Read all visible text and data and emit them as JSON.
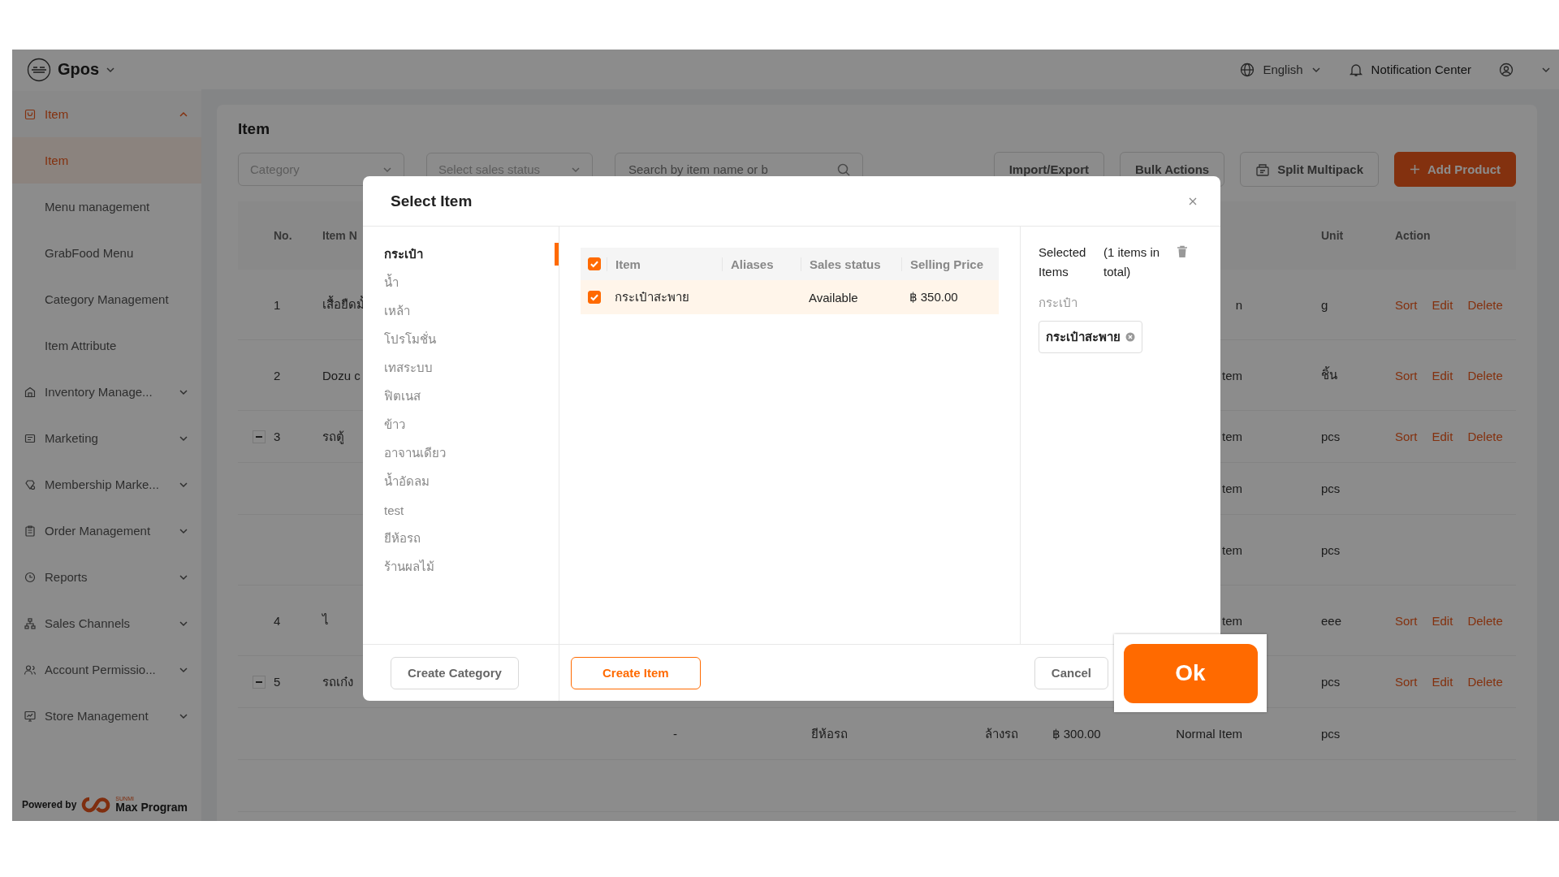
{
  "topbar": {
    "brand": "Gpos",
    "language": "English",
    "notifications": "Notification Center"
  },
  "sidebar": {
    "groups": [
      {
        "label": "Item",
        "selected": true,
        "expanded": true,
        "children": [
          {
            "label": "Item",
            "selected": true
          },
          {
            "label": "Menu management",
            "selected": false
          },
          {
            "label": "GrabFood Menu",
            "selected": false
          },
          {
            "label": "Category Management",
            "selected": false
          },
          {
            "label": "Item Attribute",
            "selected": false
          }
        ]
      },
      {
        "label": "Inventory Manage...",
        "selected": false,
        "expanded": false
      },
      {
        "label": "Marketing",
        "selected": false,
        "expanded": false
      },
      {
        "label": "Membership Marke...",
        "selected": false,
        "expanded": false
      },
      {
        "label": "Order Management",
        "selected": false,
        "expanded": false
      },
      {
        "label": "Reports",
        "selected": false,
        "expanded": false
      },
      {
        "label": "Sales Channels",
        "selected": false,
        "expanded": false
      },
      {
        "label": "Account Permissio...",
        "selected": false,
        "expanded": false
      },
      {
        "label": "Store Management",
        "selected": false,
        "expanded": false
      }
    ],
    "footer": {
      "powered_by": "Powered by",
      "logo_small": "SUNMI",
      "logo": "Max Program"
    }
  },
  "page": {
    "title": "Item",
    "filters": [
      {
        "kind": "select",
        "placeholder": "Category"
      },
      {
        "kind": "select",
        "placeholder": "Select sales status"
      },
      {
        "kind": "search",
        "placeholder": "Search by item name or b"
      }
    ],
    "buttons": [
      {
        "label": "Import/Export",
        "kind": "default"
      },
      {
        "label": "Bulk Actions",
        "kind": "default"
      },
      {
        "label": "Split Multipack",
        "kind": "split"
      },
      {
        "label": "Add Product",
        "kind": "primary"
      }
    ]
  },
  "table": {
    "columns": {
      "no": "No.",
      "item_name": "Item N",
      "unit": "Unit",
      "action": "Action"
    },
    "rows": [
      {
        "no": "1",
        "item_name": "เสื้อยืดมั้",
        "type": "n",
        "unit": "g",
        "actions": [
          "Sort",
          "Edit",
          "Delete"
        ]
      },
      {
        "no": "2",
        "item_name": "Dozu c",
        "type": "tem",
        "unit": "ชิ้น",
        "actions": [
          "Sort",
          "Edit",
          "Delete"
        ]
      },
      {
        "no": "3",
        "item_name": "รถตู้",
        "type": "tem",
        "unit": "pcs",
        "actions": [
          "Sort",
          "Edit",
          "Delete"
        ],
        "expanded": true,
        "children": [
          {
            "type": "tem",
            "unit": "pcs"
          },
          {
            "type": "tem",
            "unit": "pcs"
          }
        ]
      },
      {
        "no": "4",
        "item_name": "ไ",
        "type": "tem",
        "unit": "eee",
        "actions": [
          "Sort",
          "Edit",
          "Delete"
        ]
      },
      {
        "no": "5",
        "item_name": "รถเก๋ง",
        "unit": "pcs",
        "actions": [
          "Sort",
          "Edit",
          "Delete"
        ],
        "expanded": true,
        "children": [
          {
            "column_3": "-",
            "column_4": "ยีห้อรถ",
            "column_5": "ล้างรถ",
            "price": "฿ 300.00",
            "type": "Normal Item",
            "unit": "pcs"
          }
        ]
      }
    ]
  },
  "dialog": {
    "title": "Select Item",
    "categories": [
      {
        "label": "กระเป๋า",
        "selected": true
      },
      {
        "label": "น้ำ",
        "selected": false
      },
      {
        "label": "เหล้า",
        "selected": false
      },
      {
        "label": "โปรโมชั่น",
        "selected": false
      },
      {
        "label": "เทสระบบ",
        "selected": false
      },
      {
        "label": "ฟิตเนส",
        "selected": false
      },
      {
        "label": "ข้าว",
        "selected": false
      },
      {
        "label": "อาจานเดียว",
        "selected": false
      },
      {
        "label": "น้ำอัดลม",
        "selected": false
      },
      {
        "label": "test",
        "selected": false
      },
      {
        "label": "ยีห้อรถ",
        "selected": false
      },
      {
        "label": "ร้านผลไม้",
        "selected": false
      }
    ],
    "columns": [
      "Item",
      "Aliases",
      "Sales status",
      "Selling Price"
    ],
    "all_checked": true,
    "rows": [
      {
        "item": "กระเป๋าสะพาย",
        "sales_status": "Available",
        "price": "฿ 350.00",
        "checked": true
      }
    ],
    "selected": {
      "title": "Selected Items",
      "count": "(1 items in total)",
      "groups": [
        {
          "label": "กระเป๋า",
          "tags": [
            "กระเป๋าสะพาย"
          ]
        }
      ]
    },
    "buttons": {
      "create_category": "Create Category",
      "create_item": "Create Item",
      "cancel": "Cancel",
      "ok": "Ok"
    },
    "ok_highlighted": true
  }
}
